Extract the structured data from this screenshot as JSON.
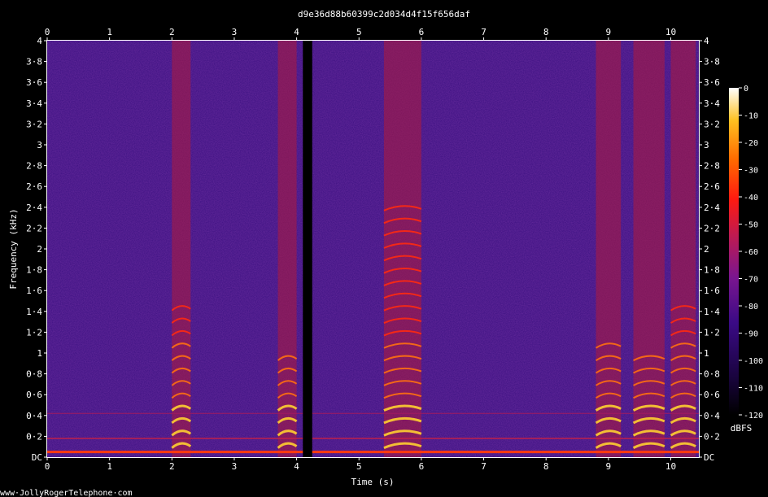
{
  "chart_data": {
    "type": "heatmap",
    "title": "d9e36d88b60399c2d034d4f15f656daf",
    "xlabel": "Time (s)",
    "ylabel": "Frequency (kHz)",
    "xlim": [
      0,
      10.45
    ],
    "ylim": [
      0,
      4
    ],
    "x_ticks": [
      "0",
      "1",
      "2",
      "3",
      "4",
      "5",
      "6",
      "7",
      "8",
      "9",
      "10"
    ],
    "y_ticks": [
      "DC",
      "0·2",
      "0·4",
      "0·6",
      "0·8",
      "1",
      "1·2",
      "1·4",
      "1·6",
      "1·8",
      "2",
      "2·2",
      "2·4",
      "2·6",
      "2·8",
      "3",
      "3·2",
      "3·4",
      "3·6",
      "3·8",
      "4"
    ],
    "colorbar": {
      "label": "dBFS",
      "ticks": [
        "-120",
        "-110",
        "-100",
        "-90",
        "-80",
        "-70",
        "-60",
        "-50",
        "-40",
        "-30",
        "-20",
        "-10",
        "0"
      ],
      "range": [
        -120,
        0
      ]
    },
    "colormap": [
      "#000000",
      "#1a0440",
      "#3a0a85",
      "#7a1690",
      "#c01a50",
      "#ff1a10",
      "#ff6a00",
      "#ffc020",
      "#ffffff"
    ],
    "speech_segments": [
      {
        "start": 2.0,
        "end": 2.3,
        "formant_max_khz": 1.4
      },
      {
        "start": 3.7,
        "end": 4.0,
        "formant_max_khz": 0.9
      },
      {
        "start": 5.4,
        "end": 6.0,
        "formant_max_khz": 2.4
      },
      {
        "start": 8.8,
        "end": 9.2,
        "formant_max_khz": 1.1
      },
      {
        "start": 9.4,
        "end": 9.9,
        "formant_max_khz": 0.9
      },
      {
        "start": 10.0,
        "end": 10.4,
        "formant_max_khz": 1.4
      }
    ],
    "silence_gap": {
      "start": 4.1,
      "end": 4.25
    }
  },
  "footer": {
    "watermark": "www·JollyRogerTelephone·com"
  }
}
